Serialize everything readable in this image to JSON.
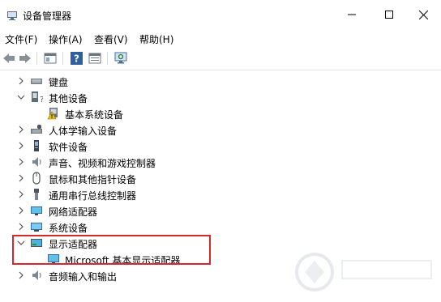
{
  "window": {
    "title": "设备管理器",
    "controls": [
      "minimize",
      "maximize",
      "close"
    ]
  },
  "menu": [
    {
      "label": "文件(F)"
    },
    {
      "label": "操作(A)"
    },
    {
      "label": "查看(V)"
    },
    {
      "label": "帮助(H)"
    }
  ],
  "toolbar": [
    "back-icon",
    "forward-icon",
    "properties-icon",
    "help-icon",
    "view-icon",
    "scan-hardware-icon"
  ],
  "tree": [
    {
      "label": "键盘",
      "icon": "keyboard-icon",
      "expanded": false
    },
    {
      "label": "其他设备",
      "icon": "unknown-device-icon",
      "expanded": true
    },
    {
      "label": "基本系统设备",
      "icon": "warning-device-icon",
      "child": true
    },
    {
      "label": "人体学输入设备",
      "icon": "hid-icon",
      "expanded": false
    },
    {
      "label": "软件设备",
      "icon": "software-device-icon",
      "expanded": false
    },
    {
      "label": "声音、视频和游戏控制器",
      "icon": "sound-icon",
      "expanded": false
    },
    {
      "label": "鼠标和其他指针设备",
      "icon": "mouse-icon",
      "expanded": false
    },
    {
      "label": "通用串行总线控制器",
      "icon": "usb-icon",
      "expanded": false
    },
    {
      "label": "网络适配器",
      "icon": "network-icon",
      "expanded": false
    },
    {
      "label": "系统设备",
      "icon": "system-device-icon",
      "expanded": false
    },
    {
      "label": "显示适配器",
      "icon": "display-adapter-icon",
      "expanded": true
    },
    {
      "label": "Microsoft 基本显示适配器",
      "icon": "monitor-icon",
      "child": true
    },
    {
      "label": "音频输入和输出",
      "icon": "audio-io-icon",
      "expanded": false
    }
  ],
  "colors": {
    "highlight": "#d4282c"
  }
}
